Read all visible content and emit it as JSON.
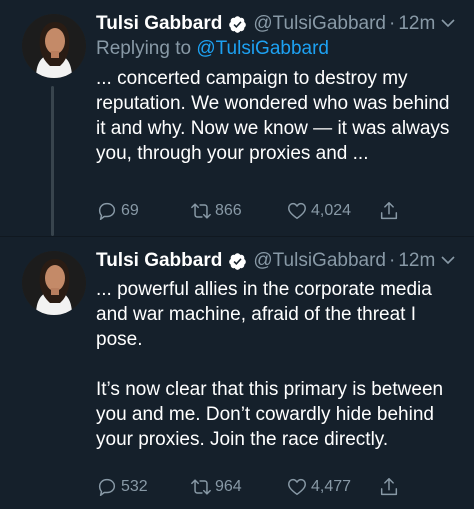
{
  "colors": {
    "background": "#15202b",
    "secondary_text": "#8899a6",
    "link": "#1da1f2",
    "verified_badge": "#ffffff"
  },
  "tweets": [
    {
      "name": "Tulsi Gabbard",
      "handle": "@TulsiGabbard",
      "separator": "·",
      "time": "12m",
      "replying_label": "Replying to",
      "replying_to": "@TulsiGabbard",
      "text": "... concerted campaign to destroy my reputation. We wondered who was behind it and why. Now we know — it was always you, through your proxies and ...",
      "replies": "69",
      "retweets": "866",
      "likes": "4,024"
    },
    {
      "name": "Tulsi Gabbard",
      "handle": "@TulsiGabbard",
      "separator": "·",
      "time": "12m",
      "text": "... powerful allies in the corporate media and war machine, afraid of the threat I pose.\n\nIt’s now clear that this primary is between you and me. Don’t cowardly hide behind your proxies. Join the race directly.",
      "replies": "532",
      "retweets": "964",
      "likes": "4,477"
    }
  ],
  "icons": {
    "verified": "verified-badge-icon",
    "more": "chevron-down-icon",
    "reply": "reply-icon",
    "retweet": "retweet-icon",
    "like": "heart-icon",
    "share": "share-icon"
  }
}
